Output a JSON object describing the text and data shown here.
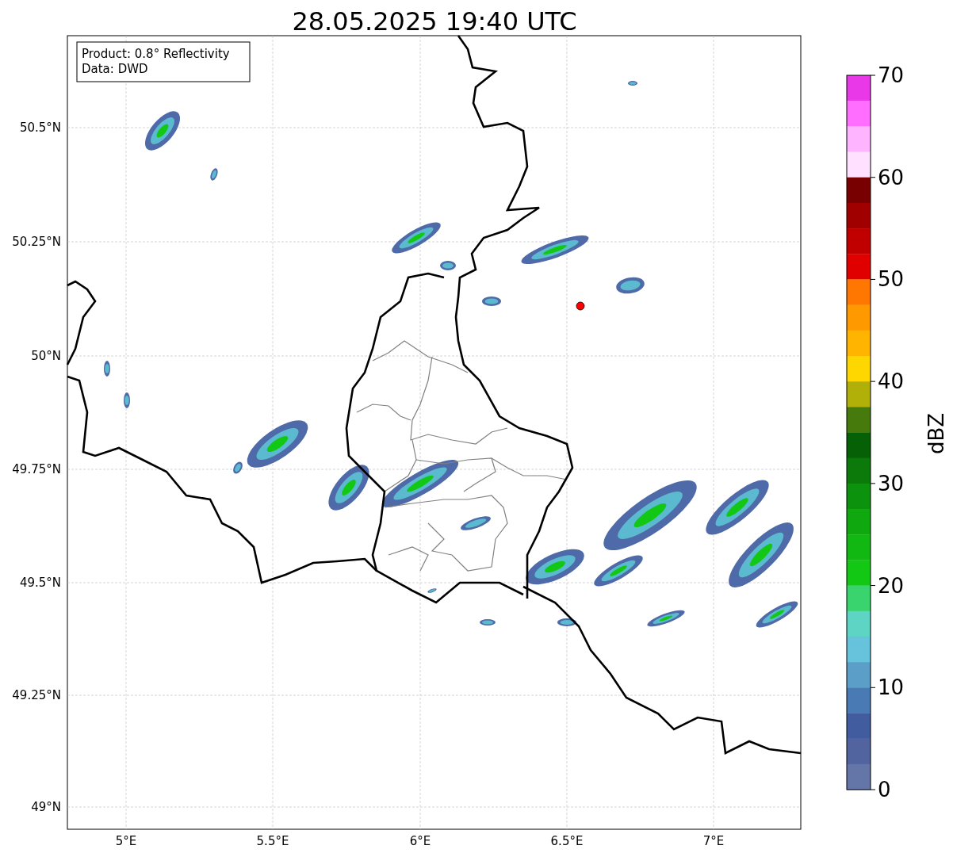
{
  "title": "28.05.2025 19:40 UTC",
  "info_box": [
    "Product: 0.8° Reflectivity",
    "Data: DWD"
  ],
  "y_ticks": [
    "50.5°N",
    "50.25°N",
    "50°N",
    "49.75°N",
    "49.5°N",
    "49.25°N",
    "49°N"
  ],
  "x_ticks": [
    "5°E",
    "5.5°E",
    "6°E",
    "6.5°E",
    "7°E"
  ],
  "colorbar": {
    "label": "dBZ",
    "ticks": [
      "70",
      "60",
      "50",
      "40",
      "30",
      "20",
      "10",
      "0"
    ],
    "bins": [
      {
        "color": "#e838e8"
      },
      {
        "color": "#ff6eff"
      },
      {
        "color": "#ffb4ff"
      },
      {
        "color": "#ffe0ff"
      },
      {
        "color": "#780000"
      },
      {
        "color": "#a00000"
      },
      {
        "color": "#c00000"
      },
      {
        "color": "#e00000"
      },
      {
        "color": "#ff7700"
      },
      {
        "color": "#ff9900"
      },
      {
        "color": "#ffb400"
      },
      {
        "color": "#ffd700"
      },
      {
        "color": "#b0b008"
      },
      {
        "color": "#467a0c"
      },
      {
        "color": "#066006"
      },
      {
        "color": "#0b7a0b"
      },
      {
        "color": "#0d920d"
      },
      {
        "color": "#0fa80f"
      },
      {
        "color": "#11b811"
      },
      {
        "color": "#12c814"
      },
      {
        "color": "#3ad46e"
      },
      {
        "color": "#5dd4c4"
      },
      {
        "color": "#67c2dc"
      },
      {
        "color": "#5b9ec8"
      },
      {
        "color": "#4a7ab3"
      },
      {
        "color": "#415da0"
      },
      {
        "color": "#51649f"
      },
      {
        "color": "#6475a8"
      }
    ]
  }
}
